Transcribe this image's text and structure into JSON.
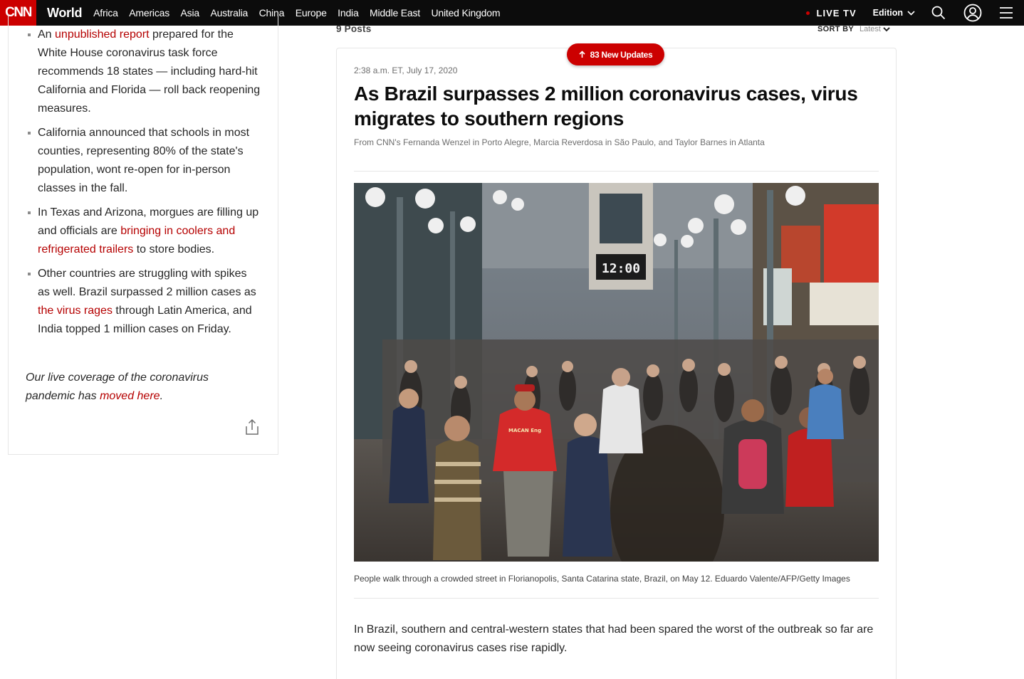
{
  "nav": {
    "logo": "CNN",
    "section": "World",
    "links": [
      "Africa",
      "Americas",
      "Asia",
      "Australia",
      "China",
      "Europe",
      "India",
      "Middle East",
      "United Kingdom"
    ],
    "live_tv": "LIVE TV",
    "edition": "Edition",
    "icons": [
      "chevron-down-icon",
      "search-icon",
      "account-icon",
      "menu-icon"
    ]
  },
  "left": {
    "bullets": [
      {
        "before": "An ",
        "link": "unpublished report",
        "after": " prepared for the White House coronavirus task force recommends 18 states — including hard-hit California and Florida — roll back reopening measures."
      },
      {
        "before": "California announced that schools in most counties, representing 80% of the state's population, wont re-open for in-person classes in the fall.",
        "link": "",
        "after": ""
      },
      {
        "before": "In Texas and Arizona, morgues are filling up and officials are ",
        "link": "bringing in coolers and refrigerated trailers",
        "after": " to store bodies."
      },
      {
        "before": "Other countries are struggling with spikes as well. Brazil surpassed 2 million cases as ",
        "link": "the virus rages",
        "after": " through Latin America, and India topped 1 million cases on Friday."
      }
    ],
    "note": {
      "before": "Our live coverage of the coronavirus pandemic has ",
      "link": "moved here",
      "after": "."
    },
    "share_icon": "share-icon"
  },
  "feed": {
    "posts_count": "9 Posts",
    "sort_by_label": "SORT BY",
    "sort_by_value": "Latest",
    "new_updates": "83 New Updates"
  },
  "post": {
    "timestamp": "2:38 a.m. ET, July 17, 2020",
    "headline": "As Brazil surpasses 2 million coronavirus cases, virus migrates to southern regions",
    "byline": "From CNN's Fernanda Wenzel in Porto Alegre, Marcia Reverdosa in São Paulo, and Taylor Barnes in Atlanta",
    "photo_clock": "12:00",
    "photo_shirt": "MACAN Eng",
    "caption": "People walk through a crowded street in Florianopolis, Santa Catarina state, Brazil, on May 12. Eduardo Valente/AFP/Getty Images",
    "body": "In Brazil, southern and central-western states that had been spared the worst of the outbreak so far are now seeing coronavirus cases rise rapidly."
  },
  "colors": {
    "brand_red": "#cc0000",
    "link_red": "#b50000",
    "nav_bg": "#0c0c0c"
  }
}
